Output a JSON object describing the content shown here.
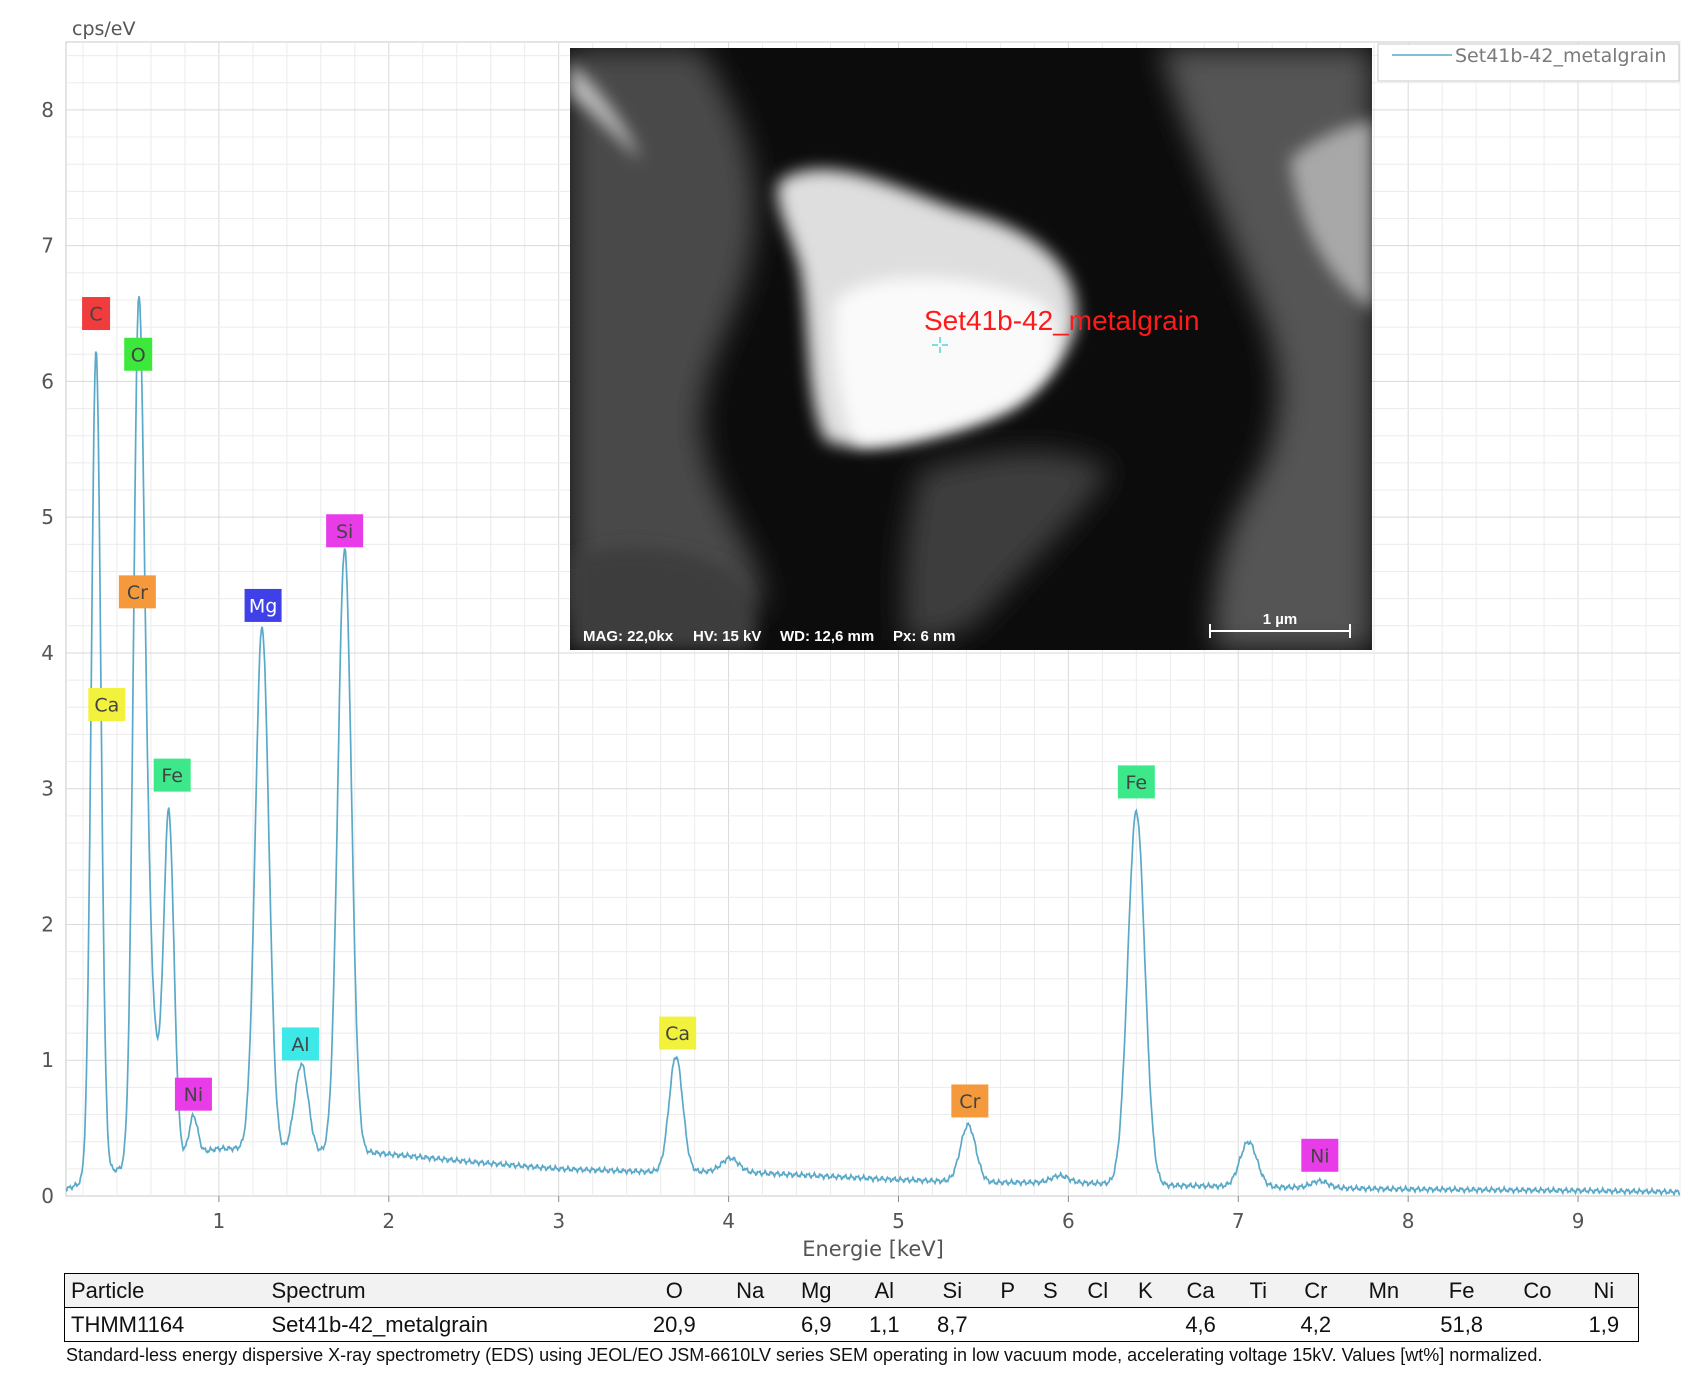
{
  "chart_data": {
    "type": "line",
    "title": "",
    "xlabel": "Energie [keV]",
    "ylabel": "cps/eV",
    "xlim": [
      0.1,
      9.6
    ],
    "ylim": [
      0,
      8.5
    ],
    "x_ticks": [
      "1",
      "2",
      "3",
      "4",
      "5",
      "6",
      "7",
      "8",
      "9"
    ],
    "y_ticks": [
      "0",
      "1",
      "2",
      "3",
      "4",
      "5",
      "6",
      "7",
      "8"
    ],
    "grid": true,
    "legend_position": "top-right",
    "series": [
      {
        "name": "Set41b-42_metalgrain",
        "color": "#5aa9c8",
        "baseline": [
          [
            0.1,
            0.05
          ],
          [
            0.2,
            0.1
          ],
          [
            0.35,
            0.18
          ],
          [
            0.5,
            0.22
          ],
          [
            0.8,
            0.3
          ],
          [
            1.0,
            0.35
          ],
          [
            1.2,
            0.35
          ],
          [
            1.5,
            0.32
          ],
          [
            1.9,
            0.32
          ],
          [
            2.5,
            0.25
          ],
          [
            3.0,
            0.2
          ],
          [
            3.5,
            0.18
          ],
          [
            4.0,
            0.18
          ],
          [
            4.5,
            0.15
          ],
          [
            5.0,
            0.12
          ],
          [
            5.5,
            0.1
          ],
          [
            6.0,
            0.1
          ],
          [
            6.5,
            0.08
          ],
          [
            7.0,
            0.07
          ],
          [
            7.5,
            0.06
          ],
          [
            8.0,
            0.05
          ],
          [
            9.0,
            0.04
          ],
          [
            9.6,
            0.03
          ]
        ],
        "peaks": [
          {
            "x": 0.277,
            "h": 6.1,
            "w": 0.028
          },
          {
            "x": 0.525,
            "h": 5.85,
            "w": 0.03
          },
          {
            "x": 0.573,
            "h": 1.8,
            "w": 0.03
          },
          {
            "x": 0.63,
            "h": 0.55,
            "w": 0.03
          },
          {
            "x": 0.705,
            "h": 2.55,
            "w": 0.03
          },
          {
            "x": 0.85,
            "h": 0.28,
            "w": 0.025
          },
          {
            "x": 1.254,
            "h": 3.85,
            "w": 0.04
          },
          {
            "x": 1.486,
            "h": 0.65,
            "w": 0.04
          },
          {
            "x": 1.74,
            "h": 4.45,
            "w": 0.04
          },
          {
            "x": 3.69,
            "h": 0.85,
            "w": 0.04
          },
          {
            "x": 4.01,
            "h": 0.1,
            "w": 0.05
          },
          {
            "x": 5.41,
            "h": 0.42,
            "w": 0.045
          },
          {
            "x": 5.95,
            "h": 0.05,
            "w": 0.05
          },
          {
            "x": 6.4,
            "h": 2.75,
            "w": 0.05
          },
          {
            "x": 7.06,
            "h": 0.33,
            "w": 0.05
          },
          {
            "x": 7.48,
            "h": 0.05,
            "w": 0.05
          }
        ]
      }
    ],
    "annotations": [
      {
        "label": "C",
        "x": 0.277,
        "y": 6.5,
        "bg": "#f03c3c"
      },
      {
        "label": "O",
        "x": 0.525,
        "y": 6.2,
        "bg": "#3ce83c"
      },
      {
        "label": "Cr",
        "x": 0.52,
        "y": 4.45,
        "bg": "#f59a3c"
      },
      {
        "label": "Ca",
        "x": 0.34,
        "y": 3.62,
        "bg": "#f2f23c"
      },
      {
        "label": "Fe",
        "x": 0.725,
        "y": 3.1,
        "bg": "#3ce88a"
      },
      {
        "label": "Mg",
        "x": 1.26,
        "y": 4.35,
        "bg": "#4040e8"
      },
      {
        "label": "Si",
        "x": 1.74,
        "y": 4.9,
        "bg": "#e83ce8"
      },
      {
        "label": "Al",
        "x": 1.48,
        "y": 1.12,
        "bg": "#3ce8e8"
      },
      {
        "label": "Ni",
        "x": 0.85,
        "y": 0.75,
        "bg": "#e83ce8"
      },
      {
        "label": "Ca",
        "x": 3.7,
        "y": 1.2,
        "bg": "#f2f23c"
      },
      {
        "label": "Cr",
        "x": 5.42,
        "y": 0.7,
        "bg": "#f59a3c"
      },
      {
        "label": "Fe",
        "x": 6.4,
        "y": 3.05,
        "bg": "#3ce88a"
      },
      {
        "label": "Ni",
        "x": 7.48,
        "y": 0.3,
        "bg": "#e83ce8"
      }
    ]
  },
  "sem_image": {
    "spot_label": "Set41b-42_metalgrain",
    "mag": "MAG: 22,0kx",
    "hv": "HV: 15 kV",
    "wd": "WD: 12,6 mm",
    "px": "Px: 6 nm",
    "scale": "1 µm"
  },
  "table": {
    "headers": [
      "Particle",
      "Spectrum",
      "O",
      "Na",
      "Mg",
      "Al",
      "Si",
      "P",
      "S",
      "Cl",
      "K",
      "Ca",
      "Ti",
      "Cr",
      "Mn",
      "Fe",
      "Co",
      "Ni"
    ],
    "row": [
      "THMM1164",
      "Set41b-42_metalgrain",
      "20,9",
      "",
      "6,9",
      "1,1",
      "8,7",
      "",
      "",
      "",
      "",
      "4,6",
      "",
      "4,2",
      "",
      "51,8",
      "",
      "1,9"
    ]
  },
  "caption": "Standard-less energy dispersive X-ray spectrometry (EDS) using JEOL/EO JSM-6610LV series SEM operating in low vacuum mode, accelerating voltage 15kV. Values [wt%] normalized."
}
